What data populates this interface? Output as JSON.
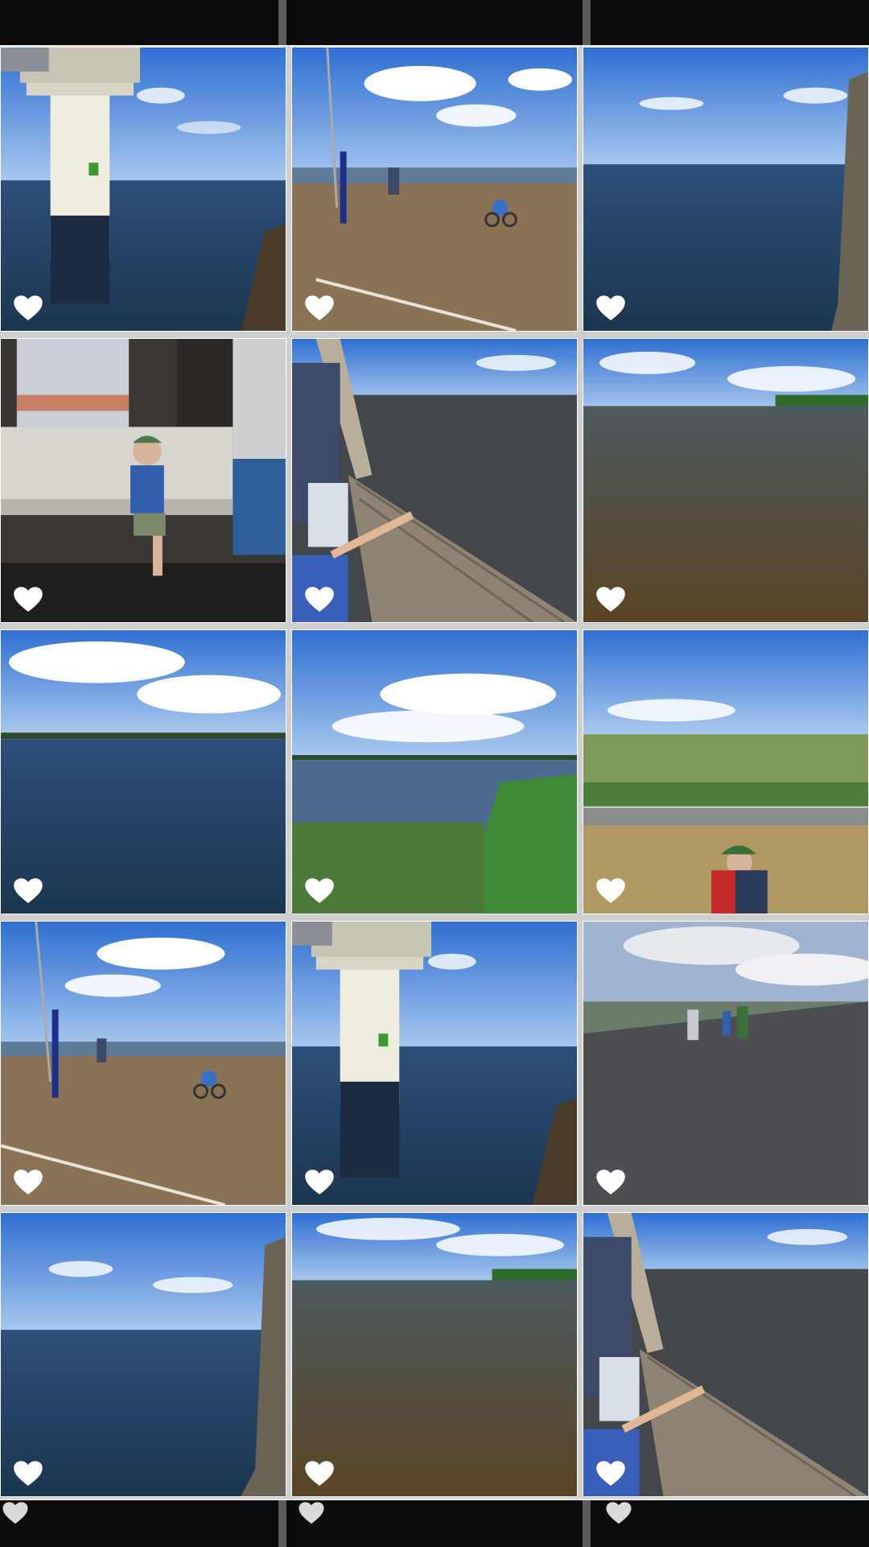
{
  "gallery": {
    "favorite_icon": "heart-outline-icon",
    "photos": [
      {
        "subject": "lighthouse-in-water"
      },
      {
        "subject": "harbor-child-on-balance-bike"
      },
      {
        "subject": "lake-with-wooden-post"
      },
      {
        "subject": "child-on-bench-indoors"
      },
      {
        "subject": "wooden-pier-pointing"
      },
      {
        "subject": "brown-lake-water"
      },
      {
        "subject": "lake-horizon-clouds"
      },
      {
        "subject": "lake-with-grassy-dike"
      },
      {
        "subject": "child-on-dike-field"
      },
      {
        "subject": "harbor-child-on-balance-bike"
      },
      {
        "subject": "lighthouse-in-water"
      },
      {
        "subject": "family-walking-on-dike-road"
      },
      {
        "subject": "lake-with-wooden-post"
      },
      {
        "subject": "brown-lake-water"
      },
      {
        "subject": "wooden-pier-pointing"
      }
    ]
  }
}
